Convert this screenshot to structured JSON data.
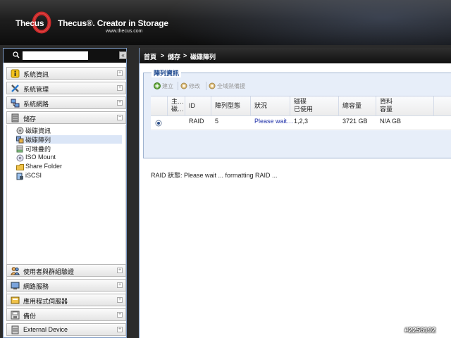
{
  "header": {
    "logo": "Thecus",
    "tagline": "Thecus®. Creator in Storage",
    "url": "www.thecus.com"
  },
  "sidebar": {
    "search_placeholder": "",
    "collapse_label": "«",
    "groups": [
      {
        "label": "系統資訊",
        "icon": "info-icon",
        "toggle": "+"
      },
      {
        "label": "系統管理",
        "icon": "tools-icon",
        "toggle": "+"
      },
      {
        "label": "系統網路",
        "icon": "network-icon",
        "toggle": "+"
      },
      {
        "label": "儲存",
        "icon": "storage-icon",
        "toggle": "−"
      },
      {
        "label": "使用者與群組驗證",
        "icon": "users-icon",
        "toggle": "+"
      },
      {
        "label": "網路服務",
        "icon": "network-service-icon",
        "toggle": "+"
      },
      {
        "label": "應用程式伺服器",
        "icon": "app-server-icon",
        "toggle": "+"
      },
      {
        "label": "備份",
        "icon": "backup-icon",
        "toggle": "+"
      },
      {
        "label": "External Device",
        "icon": "external-device-icon",
        "toggle": "+"
      }
    ],
    "storage_items": [
      {
        "label": "磁碟資訊",
        "icon": "disk-info-icon"
      },
      {
        "label": "磁碟陣列",
        "icon": "raid-icon",
        "active": true
      },
      {
        "label": "可堆疊的",
        "icon": "stack-icon"
      },
      {
        "label": "ISO Mount",
        "icon": "iso-icon"
      },
      {
        "label": "Share Folder",
        "icon": "folder-icon"
      },
      {
        "label": "iSCSI",
        "icon": "iscsi-icon"
      }
    ]
  },
  "breadcrumb": {
    "home": "首頁",
    "sep1": ">",
    "level1": "儲存",
    "sep2": ">",
    "level2": "磁碟陣列"
  },
  "panel": {
    "title": "陣列資訊",
    "toolbar": {
      "create": "建立",
      "edit": "修改",
      "global_hot_spare": "全域熱備援"
    },
    "columns": [
      "主…\n磁…",
      "ID",
      "陣列型態",
      "狀況",
      "磁碟\n已使用",
      "總容量",
      "資料\n容量"
    ],
    "rows": [
      {
        "selected": true,
        "master": "",
        "id": "RAID",
        "level": "5",
        "status": "Please wait…",
        "disks": "1,2,3",
        "total": "3721 GB",
        "data": "N/A GB"
      }
    ],
    "raid_status": "RAID 狀態: Please wait ... formatting RAID ..."
  },
  "watermark": "#2256192",
  "colors": {
    "accent_blue": "#15428b",
    "status_link": "#2233aa",
    "panel_bg": "#e7eef9"
  }
}
